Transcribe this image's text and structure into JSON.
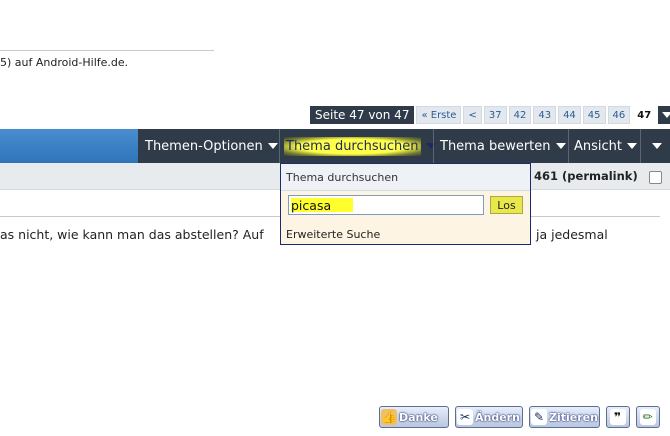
{
  "forum_line": "5) auf Android-Hilfe.de.",
  "pagination": {
    "label": "Seite 47 von 47",
    "first": "« Erste",
    "prev": "<",
    "pages": [
      "37",
      "42",
      "43",
      "44",
      "45",
      "46"
    ],
    "current": "47",
    "dropdown_icon": "triangle-down-icon"
  },
  "toolbar": {
    "items": [
      {
        "label": "Themen-Optionen"
      },
      {
        "label": "Thema durchsuchen",
        "highlighted": true
      },
      {
        "label": "Thema bewerten"
      },
      {
        "label": "Ansicht"
      }
    ],
    "accent_color": "#2f3b48",
    "active_highlight_color": "#ffff2e"
  },
  "post": {
    "number_fragment": "461",
    "permalink": "(permalink)",
    "text_left": "as nicht, wie kann man das abstellen? Auf",
    "text_right": "ja jedesmal"
  },
  "search_dropdown": {
    "title": "Thema durchsuchen",
    "input_value": "picasa",
    "button_label": "Los",
    "advanced_link": "Erweiterte Suche"
  },
  "post_buttons": {
    "thanks": "Danke",
    "edit": "Ändern",
    "quote": "Zitieren"
  }
}
